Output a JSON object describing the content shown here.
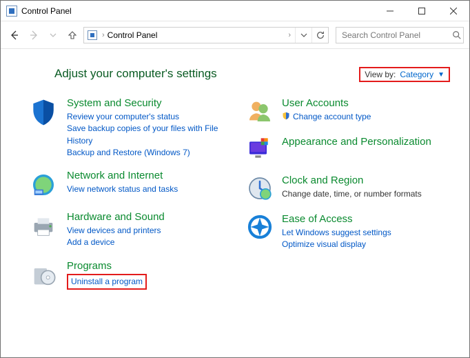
{
  "window": {
    "title": "Control Panel"
  },
  "nav": {
    "breadcrumb": "Control Panel",
    "search_placeholder": "Search Control Panel"
  },
  "heading": "Adjust your computer's settings",
  "viewby": {
    "label": "View by:",
    "value": "Category"
  },
  "cats": {
    "system": {
      "title": "System and Security",
      "links": [
        "Review your computer's status",
        "Save backup copies of your files with File History",
        "Backup and Restore (Windows 7)"
      ]
    },
    "network": {
      "title": "Network and Internet",
      "links": [
        "View network status and tasks"
      ]
    },
    "hardware": {
      "title": "Hardware and Sound",
      "links": [
        "View devices and printers",
        "Add a device"
      ]
    },
    "programs": {
      "title": "Programs",
      "links": [
        "Uninstall a program"
      ]
    },
    "users": {
      "title": "User Accounts",
      "links": [
        "Change account type"
      ]
    },
    "appearance": {
      "title": "Appearance and Personalization"
    },
    "clock": {
      "title": "Clock and Region",
      "links": [
        "Change date, time, or number formats"
      ]
    },
    "ease": {
      "title": "Ease of Access",
      "links": [
        "Let Windows suggest settings",
        "Optimize visual display"
      ]
    }
  }
}
